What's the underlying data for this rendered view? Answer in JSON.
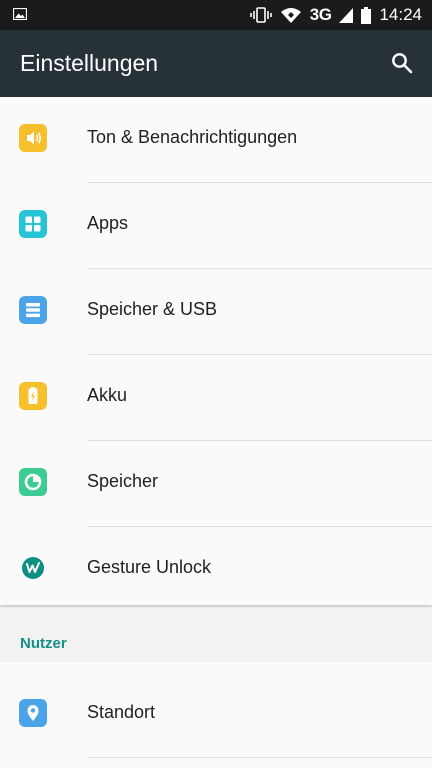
{
  "status_bar": {
    "network": "3G",
    "time": "14:24"
  },
  "app_bar": {
    "title": "Einstellungen",
    "search_icon": "search-icon"
  },
  "colors": {
    "status_bar_bg": "#1a1b1d",
    "app_bar_bg": "#263238",
    "section_accent": "#168f86"
  },
  "device_items": [
    {
      "label": "Ton & Benachrichtigungen",
      "icon": "sound-icon",
      "color": "#f6c02c"
    },
    {
      "label": "Apps",
      "icon": "apps-icon",
      "color": "#27c4d6"
    },
    {
      "label": "Speicher & USB",
      "icon": "storage-icon",
      "color": "#4ca4e8"
    },
    {
      "label": "Akku",
      "icon": "battery-icon",
      "color": "#f6c02c"
    },
    {
      "label": "Speicher",
      "icon": "memory-icon",
      "color": "#3ccc92"
    },
    {
      "label": "Gesture Unlock",
      "icon": "gesture-unlock-icon",
      "color": "#0f8e82"
    }
  ],
  "sections": {
    "user_title": "Nutzer"
  },
  "user_items": [
    {
      "label": "Standort",
      "icon": "location-icon",
      "color": "#4ca4e8"
    }
  ]
}
